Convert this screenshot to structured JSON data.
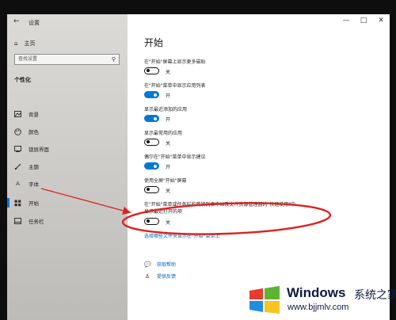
{
  "window": {
    "back_icon": "back-arrow-icon",
    "title": "设置",
    "controls": [
      "—",
      "□",
      "✕"
    ]
  },
  "sidebar": {
    "home_label": "主页",
    "search_placeholder": "查找设置",
    "section_title": "个性化",
    "items": [
      {
        "label": "背景",
        "icon": "picture-icon"
      },
      {
        "label": "颜色",
        "icon": "palette-icon"
      },
      {
        "label": "锁屏界面",
        "icon": "lock-screen-icon"
      },
      {
        "label": "主题",
        "icon": "brush-icon"
      },
      {
        "label": "字体",
        "icon": "font-icon"
      },
      {
        "label": "开始",
        "icon": "start-icon",
        "active": true
      },
      {
        "label": "任务栏",
        "icon": "taskbar-icon"
      }
    ]
  },
  "main": {
    "title": "开始",
    "options": [
      {
        "label": "在\"开始\"屏幕上显示更多磁贴",
        "state": "关",
        "on": false
      },
      {
        "label": "在\"开始\"菜单中显示应用列表",
        "state": "开",
        "on": true
      },
      {
        "label": "显示最近添加的应用",
        "state": "开",
        "on": true
      },
      {
        "label": "显示最常用的应用",
        "state": "关",
        "on": false
      },
      {
        "label": "偶尔在\"开始\"菜单中显示建议",
        "state": "开",
        "on": true
      },
      {
        "label": "使用全屏\"开始\"屏幕",
        "state": "关",
        "on": false
      },
      {
        "label_line1": "在\"开始\"菜单或任务栏的跳转列表中以及文件资源管理器的\"快速使用\"中",
        "label_line2": "显示最近打开的项",
        "state": "关",
        "on": false
      }
    ],
    "folder_link": "选择哪些文件夹显示在\"开始\"菜单上",
    "help_link": "获取帮助",
    "feedback_link": "提供反馈"
  },
  "watermark": {
    "brand": "Windows",
    "brand_cn": "系统之家",
    "url": "www.bjjmlv.com"
  },
  "colors": {
    "accent": "#0078d7",
    "annotation": "#e02020"
  }
}
